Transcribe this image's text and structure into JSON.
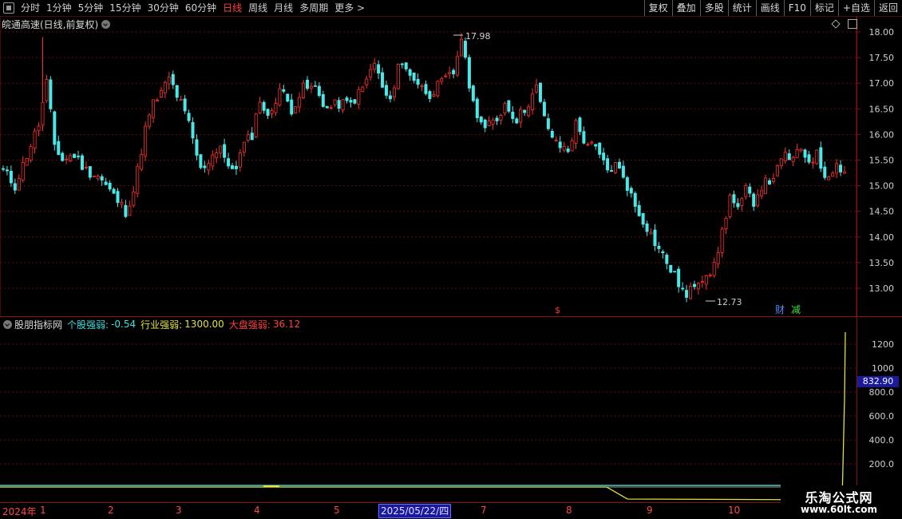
{
  "toolbar": {
    "periods": [
      {
        "label": "分时",
        "active": false
      },
      {
        "label": "1分钟",
        "active": false
      },
      {
        "label": "5分钟",
        "active": false
      },
      {
        "label": "15分钟",
        "active": false
      },
      {
        "label": "30分钟",
        "active": false
      },
      {
        "label": "60分钟",
        "active": false
      },
      {
        "label": "日线",
        "active": true
      },
      {
        "label": "周线",
        "active": false
      },
      {
        "label": "月线",
        "active": false
      },
      {
        "label": "多周期",
        "active": false
      },
      {
        "label": "更多 >",
        "active": false
      }
    ],
    "tools": [
      "复权",
      "叠加",
      "多股",
      "统计",
      "画线",
      "F10",
      "标记",
      "+自选",
      "返回"
    ]
  },
  "stock": {
    "title": "皖通高速(日线,前复权)"
  },
  "price_axis": {
    "labels": [
      "18.00",
      "17.50",
      "17.00",
      "16.50",
      "16.00",
      "15.50",
      "15.00",
      "14.50",
      "14.00",
      "13.50",
      "13.00"
    ]
  },
  "markers": {
    "high": "17.98",
    "low": "12.73",
    "dividend_mark": "$",
    "cai": "财",
    "jian": "减"
  },
  "indicator": {
    "name": "股朋指标网",
    "items": [
      {
        "label": "个股强弱:",
        "value": "-0.54",
        "color": "#3ae0e0"
      },
      {
        "label": "行业强弱:",
        "value": "1300.00",
        "color": "#e0e040"
      },
      {
        "label": "大盘强弱:",
        "value": "36.12",
        "color": "#ff4040"
      }
    ],
    "axis_labels": [
      "1200",
      "1000",
      "800.0",
      "600.0",
      "400.0",
      "200.0"
    ],
    "current_value": "832.90"
  },
  "dates": {
    "year_label": "2024年",
    "month_ticks": [
      "1",
      "2",
      "3",
      "4",
      "5",
      "7",
      "8",
      "9",
      "10"
    ],
    "selected_date": "2025/05/22/四"
  },
  "watermark": {
    "title": "乐淘公式网",
    "url": "www.60lt.com"
  },
  "colors": {
    "up": "#ff3030",
    "down": "#4ae8e8",
    "grid": "#6a0a0a",
    "axis": "#8a1010",
    "industry": "#e0e040"
  },
  "chart_data": {
    "type": "candlestick",
    "ylim": [
      12.7,
      18.0
    ],
    "extremes": {
      "high": 17.98,
      "low": 12.73
    },
    "anchors": [
      [
        0,
        15.3
      ],
      [
        3,
        15.0
      ],
      [
        6,
        15.6
      ],
      [
        9,
        16.2
      ],
      [
        11,
        17.0
      ],
      [
        13,
        15.8
      ],
      [
        15,
        15.5
      ],
      [
        18,
        15.6
      ],
      [
        21,
        15.3
      ],
      [
        24,
        15.2
      ],
      [
        28,
        14.8
      ],
      [
        31,
        14.5
      ],
      [
        33,
        14.9
      ],
      [
        36,
        16.1
      ],
      [
        38,
        16.6
      ],
      [
        40,
        16.8
      ],
      [
        42,
        17.1
      ],
      [
        45,
        16.6
      ],
      [
        47,
        16.2
      ],
      [
        50,
        15.3
      ],
      [
        52,
        15.5
      ],
      [
        55,
        15.8
      ],
      [
        57,
        15.3
      ],
      [
        59,
        15.4
      ],
      [
        61,
        15.8
      ],
      [
        63,
        16.0
      ],
      [
        65,
        16.7
      ],
      [
        67,
        16.3
      ],
      [
        68,
        16.5
      ],
      [
        70,
        16.9
      ],
      [
        73,
        16.5
      ],
      [
        76,
        16.9
      ],
      [
        79,
        16.9
      ],
      [
        82,
        16.5
      ],
      [
        85,
        16.6
      ],
      [
        88,
        16.6
      ],
      [
        91,
        16.9
      ],
      [
        94,
        17.4
      ],
      [
        96,
        16.9
      ],
      [
        98,
        16.6
      ],
      [
        100,
        17.4
      ],
      [
        103,
        17.2
      ],
      [
        106,
        16.9
      ],
      [
        108,
        16.8
      ],
      [
        111,
        17.0
      ],
      [
        114,
        17.2
      ],
      [
        116,
        17.9
      ],
      [
        117,
        17.4
      ],
      [
        119,
        16.6
      ],
      [
        122,
        16.1
      ],
      [
        125,
        16.3
      ],
      [
        127,
        16.6
      ],
      [
        130,
        16.3
      ],
      [
        132,
        16.5
      ],
      [
        135,
        16.9
      ],
      [
        137,
        16.3
      ],
      [
        140,
        15.8
      ],
      [
        143,
        15.7
      ],
      [
        145,
        16.2
      ],
      [
        147,
        15.9
      ],
      [
        150,
        15.7
      ],
      [
        153,
        15.3
      ],
      [
        155,
        15.4
      ],
      [
        157,
        15.2
      ],
      [
        160,
        14.6
      ],
      [
        163,
        14.2
      ],
      [
        165,
        13.9
      ],
      [
        168,
        13.5
      ],
      [
        171,
        13.1
      ],
      [
        173,
        12.8
      ],
      [
        175,
        13.1
      ],
      [
        178,
        13.3
      ],
      [
        180,
        13.4
      ],
      [
        182,
        14.1
      ],
      [
        184,
        14.8
      ],
      [
        186,
        14.5
      ],
      [
        188,
        14.9
      ],
      [
        190,
        14.7
      ],
      [
        192,
        15.0
      ],
      [
        194,
        15.1
      ],
      [
        196,
        15.3
      ],
      [
        198,
        15.6
      ],
      [
        200,
        15.5
      ],
      [
        202,
        15.7
      ],
      [
        204,
        15.5
      ],
      [
        206,
        15.6
      ],
      [
        208,
        15.2
      ],
      [
        211,
        15.4
      ],
      [
        213,
        15.3
      ]
    ],
    "industry_line": {
      "baseline_value": 0,
      "final_value": 1300.0,
      "current_value": 832.9
    }
  }
}
